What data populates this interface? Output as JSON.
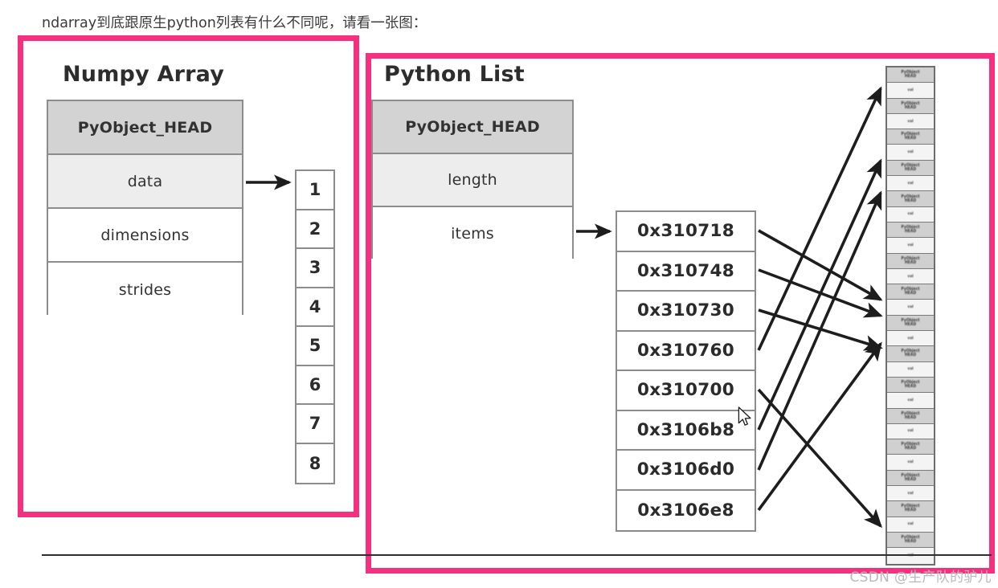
{
  "article": {
    "caption": "ndarray到底跟原生python列表有什么不同呢，请看一张图：",
    "watermark": "CSDN @生产队的驴儿"
  },
  "colors": {
    "annotation_pink": "#f5317f",
    "header_gray": "#d3d3d3",
    "shaded_gray": "#ededed",
    "border_gray": "#8c8c8c",
    "text_dark": "#2d2d2d"
  },
  "diagram": {
    "numpy": {
      "title": "Numpy Array",
      "struct_rows": [
        {
          "label": "PyObject_HEAD",
          "style": "head"
        },
        {
          "label": "data",
          "style": "shaded"
        },
        {
          "label": "dimensions",
          "style": "plain"
        },
        {
          "label": "strides",
          "style": "plain"
        }
      ],
      "buffer_values": [
        "1",
        "2",
        "3",
        "4",
        "5",
        "6",
        "7",
        "8"
      ]
    },
    "python": {
      "title": "Python List",
      "struct_rows": [
        {
          "label": "PyObject_HEAD",
          "style": "head"
        },
        {
          "label": "length",
          "style": "shaded"
        },
        {
          "label": "items",
          "style": "plain"
        }
      ],
      "pointer_addresses": [
        "0x310718",
        "0x310748",
        "0x310730",
        "0x310760",
        "0x310700",
        "0x3106b8",
        "0x3106d0",
        "0x3106e8"
      ],
      "object_cells": [
        {
          "label": "PyObject\nHEAD",
          "style": "head"
        },
        {
          "label": "val",
          "style": "val"
        },
        {
          "label": "PyObject\nHEAD",
          "style": "head"
        },
        {
          "label": "val",
          "style": "val"
        },
        {
          "label": "PyObject\nHEAD",
          "style": "head"
        },
        {
          "label": "val",
          "style": "val"
        },
        {
          "label": "PyObject\nHEAD",
          "style": "head"
        },
        {
          "label": "val",
          "style": "val"
        },
        {
          "label": "PyObject\nHEAD",
          "style": "head"
        },
        {
          "label": "val",
          "style": "val"
        },
        {
          "label": "PyObject\nHEAD",
          "style": "head"
        },
        {
          "label": "val",
          "style": "val"
        },
        {
          "label": "PyObject\nHEAD",
          "style": "head"
        },
        {
          "label": "val",
          "style": "val"
        },
        {
          "label": "PyObject\nHEAD",
          "style": "head"
        },
        {
          "label": "val",
          "style": "val"
        },
        {
          "label": "PyObject\nHEAD",
          "style": "head"
        },
        {
          "label": "val",
          "style": "val"
        },
        {
          "label": "PyObject\nHEAD",
          "style": "head"
        },
        {
          "label": "val",
          "style": "val"
        },
        {
          "label": "PyObject\nHEAD",
          "style": "head"
        },
        {
          "label": "val",
          "style": "val"
        },
        {
          "label": "PyObject\nHEAD",
          "style": "head"
        },
        {
          "label": "val",
          "style": "val"
        },
        {
          "label": "PyObject\nHEAD",
          "style": "head"
        },
        {
          "label": "val",
          "style": "val"
        },
        {
          "label": "PyObject\nHEAD",
          "style": "head"
        },
        {
          "label": "val",
          "style": "val"
        },
        {
          "label": "PyObject\nHEAD",
          "style": "head"
        },
        {
          "label": "val",
          "style": "val"
        },
        {
          "label": "PyObject\nHEAD",
          "style": "head"
        },
        {
          "label": "val",
          "style": "val"
        }
      ]
    }
  },
  "annotations": {
    "boxes": [
      {
        "name": "numpy-array-highlight"
      },
      {
        "name": "python-list-highlight"
      }
    ]
  }
}
